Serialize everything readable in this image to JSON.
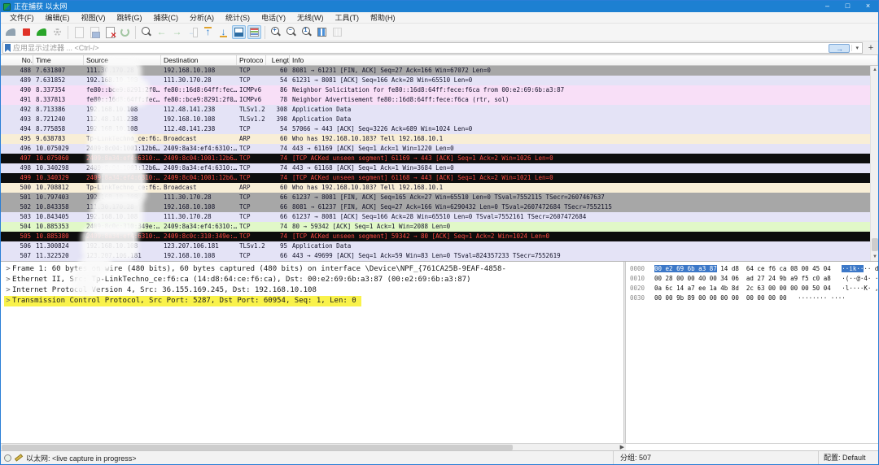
{
  "window": {
    "title": "正在捕获 以太网",
    "controls": {
      "min": "–",
      "max": "□",
      "close": "×"
    }
  },
  "menu": {
    "items": [
      "文件(F)",
      "编辑(E)",
      "视图(V)",
      "跳转(G)",
      "捕获(C)",
      "分析(A)",
      "统计(S)",
      "电话(Y)",
      "无线(W)",
      "工具(T)",
      "帮助(H)"
    ]
  },
  "toolbar": {
    "icons": [
      {
        "name": "start-capture-icon",
        "type": "fin-start",
        "disabled": true
      },
      {
        "name": "stop-capture-icon",
        "type": "stop"
      },
      {
        "name": "restart-capture-icon",
        "type": "fin-restart"
      },
      {
        "name": "capture-options-gear-icon",
        "type": "gear",
        "disabled": true
      },
      {
        "sep": true
      },
      {
        "name": "open-file-icon",
        "type": "doc",
        "disabled": true
      },
      {
        "name": "save-file-icon",
        "type": "doc-save",
        "disabled": true
      },
      {
        "name": "close-file-icon",
        "type": "doc-close"
      },
      {
        "name": "reload-icon",
        "type": "reload",
        "disabled": true
      },
      {
        "sep": true
      },
      {
        "name": "find-packet-icon",
        "type": "mag"
      },
      {
        "name": "go-back-icon",
        "type": "arrow-left",
        "disabled": true
      },
      {
        "name": "go-forward-icon",
        "type": "arrow-right",
        "disabled": true
      },
      {
        "name": "go-to-packet-icon",
        "type": "goto",
        "disabled": true
      },
      {
        "name": "go-first-packet-icon",
        "type": "arrow-top"
      },
      {
        "name": "go-last-packet-icon",
        "type": "arrow-bottom"
      },
      {
        "name": "auto-scroll-icon",
        "type": "autoscroll",
        "active": true
      },
      {
        "name": "colorize-icon",
        "type": "colorize",
        "active": true
      },
      {
        "sep": true
      },
      {
        "name": "zoom-in-icon",
        "type": "mag-plus",
        "glyph": "+"
      },
      {
        "name": "zoom-out-icon",
        "type": "mag-minus",
        "glyph": "−"
      },
      {
        "name": "zoom-100-icon",
        "type": "mag-one",
        "glyph": "1"
      },
      {
        "name": "resize-columns-icon",
        "type": "cols"
      },
      {
        "name": "layout-icon",
        "type": "grid",
        "disabled": true
      }
    ]
  },
  "filter": {
    "placeholder": "应用显示过滤器 ... <Ctrl-/>",
    "apply_arrow": "→",
    "caret": "▾",
    "plus": "+"
  },
  "packet_list": {
    "columns": [
      "No.",
      "Time",
      "Source",
      "Destination",
      "Protoco",
      "Lengt",
      "Info"
    ],
    "rows": [
      {
        "no": "488",
        "time": "7.631807",
        "src": "111.30.170.28",
        "dst": "192.168.10.108",
        "proto": "TCP",
        "len": "60",
        "info": "8081 → 61231 [FIN, ACK] Seq=27 Ack=166 Win=67072 Len=0",
        "color": "gray"
      },
      {
        "no": "489",
        "time": "7.631852",
        "src": "192.168.10.108",
        "dst": "111.30.170.28",
        "proto": "TCP",
        "len": "54",
        "info": "61231 → 8081 [ACK] Seq=166 Ack=28 Win=65510 Len=0",
        "color": "lavender"
      },
      {
        "no": "490",
        "time": "8.337354",
        "src": "fe80::bce9:8291:2f0…",
        "dst": "fe80::16d8:64ff:fec…",
        "proto": "ICMPv6",
        "len": "86",
        "info": "Neighbor Solicitation for fe80::16d8:64ff:fece:f6ca from 00:e2:69:6b:a3:87",
        "color": "pink"
      },
      {
        "no": "491",
        "time": "8.337813",
        "src": "fe80::16d8:64ff:fec…",
        "dst": "fe80::bce9:8291:2f0…",
        "proto": "ICMPv6",
        "len": "78",
        "info": "Neighbor Advertisement fe80::16d8:64ff:fece:f6ca (rtr, sol)",
        "color": "pink"
      },
      {
        "no": "492",
        "time": "8.713386",
        "src": "192.168.10.108",
        "dst": "112.48.141.238",
        "proto": "TLSv1.2",
        "len": "308",
        "info": "Application Data",
        "color": "lavender"
      },
      {
        "no": "493",
        "time": "8.721240",
        "src": "112.48.141.238",
        "dst": "192.168.10.108",
        "proto": "TLSv1.2",
        "len": "398",
        "info": "Application Data",
        "color": "lavender"
      },
      {
        "no": "494",
        "time": "8.775858",
        "src": "192.168.10.108",
        "dst": "112.48.141.238",
        "proto": "TCP",
        "len": "54",
        "info": "57066 → 443 [ACK] Seq=3226 Ack=689 Win=1024 Len=0",
        "color": "lavender"
      },
      {
        "no": "495",
        "time": "9.638783",
        "src": "Tp-LinkTechno_ce:f6:…",
        "dst": "Broadcast",
        "proto": "ARP",
        "len": "60",
        "info": "Who has 192.168.10.103? Tell 192.168.10.1",
        "color": "cream"
      },
      {
        "no": "496",
        "time": "10.075029",
        "src": "2409:8c04:1001:12b6…",
        "dst": "2409:8a34:ef4:6310:…",
        "proto": "TCP",
        "len": "74",
        "info": "443 → 61169 [ACK] Seq=1 Ack=1 Win=1220 Len=0",
        "color": "lavender"
      },
      {
        "no": "497",
        "time": "10.075060",
        "src": "2409:8a34:ef4:6310:…",
        "dst": "2409:8c04:1001:12b6…",
        "proto": "TCP",
        "len": "74",
        "info": "[TCP ACKed unseen segment] 61169 → 443 [ACK] Seq=1 Ack=2 Win=1026 Len=0",
        "color": "black"
      },
      {
        "no": "498",
        "time": "10.340298",
        "src": "2409:8c04:1001:12b6…",
        "dst": "2409:8a34:ef4:6310:…",
        "proto": "TCP",
        "len": "74",
        "info": "443 → 61168 [ACK] Seq=1 Ack=1 Win=3684 Len=0",
        "color": "lavender"
      },
      {
        "no": "499",
        "time": "10.340329",
        "src": "2409:8a34:ef4:6310:…",
        "dst": "2409:8c04:1001:12b6…",
        "proto": "TCP",
        "len": "74",
        "info": "[TCP ACKed unseen segment] 61168 → 443 [ACK] Seq=1 Ack=2 Win=1021 Len=0",
        "color": "black"
      },
      {
        "no": "500",
        "time": "10.708812",
        "src": "Tp-LinkTechno_ce:f6:…",
        "dst": "Broadcast",
        "proto": "ARP",
        "len": "60",
        "info": "Who has 192.168.10.103? Tell 192.168.10.1",
        "color": "cream"
      },
      {
        "no": "501",
        "time": "10.797403",
        "src": "192.168.10.108",
        "dst": "111.30.170.28",
        "proto": "TCP",
        "len": "66",
        "info": "61237 → 8081 [FIN, ACK] Seq=165 Ack=27 Win=65510 Len=0 TSval=7552115 TSecr=2607467637",
        "color": "gray"
      },
      {
        "no": "502",
        "time": "10.843358",
        "src": "111.30.170.28",
        "dst": "192.168.10.108",
        "proto": "TCP",
        "len": "66",
        "info": "8081 → 61237 [FIN, ACK] Seq=27 Ack=166 Win=6290432 Len=0 TSval=2607472684 TSecr=7552115",
        "color": "gray"
      },
      {
        "no": "503",
        "time": "10.843405",
        "src": "192.168.10.108",
        "dst": "111.30.170.28",
        "proto": "TCP",
        "len": "66",
        "info": "61237 → 8081 [ACK] Seq=166 Ack=28 Win=65510 Len=0 TSval=7552161 TSecr=2607472684",
        "color": "lavender"
      },
      {
        "no": "504",
        "time": "10.885353",
        "src": "2409:8c0c:310:349e:…",
        "dst": "2409:8a34:ef4:6310:…",
        "proto": "TCP",
        "len": "74",
        "info": "80 → 59342 [ACK] Seq=1 Ack=1 Win=2088 Len=0",
        "color": "green"
      },
      {
        "no": "505",
        "time": "10.885380",
        "src": "2409:8a34:ef4:6310:…",
        "dst": "2409:8c0c:310:349e:…",
        "proto": "TCP",
        "len": "74",
        "info": "[TCP ACKed unseen segment] 59342 → 80 [ACK] Seq=1 Ack=2 Win=1024 Len=0",
        "color": "black"
      },
      {
        "no": "506",
        "time": "11.300824",
        "src": "192.168.10.108",
        "dst": "123.207.106.181",
        "proto": "TLSv1.2",
        "len": "95",
        "info": "Application Data",
        "color": "lavender"
      },
      {
        "no": "507",
        "time": "11.322520",
        "src": "123.207.106.181",
        "dst": "192.168.10.108",
        "proto": "TCP",
        "len": "66",
        "info": "443 → 49699 [ACK] Seq=1 Ack=59 Win=83 Len=0 TSval=824357233 TSecr=7552619",
        "color": "lavender"
      }
    ]
  },
  "details": {
    "expander": ">",
    "lines": [
      {
        "text": "Frame 1: 60 bytes on wire (480 bits), 60 bytes captured (480 bits) on interface \\Device\\NPF_{761CA25B-9EAF-4858-"
      },
      {
        "text": "Ethernet II, Src: Tp-LinkTechno_ce:f6:ca (14:d8:64:ce:f6:ca), Dst: 00:e2:69:6b:a3:87 (00:e2:69:6b:a3:87)"
      },
      {
        "text": "Internet Protocol Version 4, Src: 36.155.169.245, Dst: 192.168.10.108"
      },
      {
        "text": "Transmission Control Protocol, Src Port: 5287, Dst Port: 60954, Seq: 1, Len: 0",
        "highlight": true
      }
    ]
  },
  "hex": {
    "lines": [
      {
        "offset": "0000",
        "hex_sel": "00 e2 69 6b a3 87",
        "hex_rest": " 14 d8  64 ce f6 ca 08 00 45 04",
        "ascii_sel": "··ik··",
        "ascii_rest": "·· d·····E·"
      },
      {
        "offset": "0010",
        "hex_sel": "",
        "hex_rest": "00 28 00 00 40 00 34 06  ad 27 24 9b a9 f5 c0 a8",
        "ascii_sel": "",
        "ascii_rest": "·(··@·4· ·'$·····"
      },
      {
        "offset": "0020",
        "hex_sel": "",
        "hex_rest": "0a 6c 14 a7 ee 1a 4b 8d  2c 63 00 00 00 00 50 04",
        "ascii_sel": "",
        "ascii_rest": "·l····K· ,c····P·"
      },
      {
        "offset": "0030",
        "hex_sel": "",
        "hex_rest": "00 00 9b 89 00 00 00 00  00 00 00 00",
        "ascii_sel": "",
        "ascii_rest": "········ ····"
      }
    ]
  },
  "status": {
    "capture": "以太网: <live capture in progress>",
    "packets": "分组: 507",
    "profile": "配置: Default"
  }
}
